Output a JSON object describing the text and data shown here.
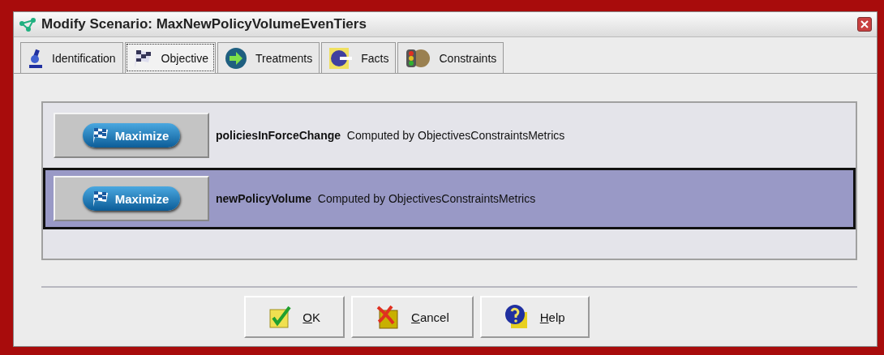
{
  "window": {
    "title": "Modify Scenario: MaxNewPolicyVolumeEvenTiers"
  },
  "tabs": [
    {
      "label": "Identification",
      "kind": "microscope",
      "selected": false
    },
    {
      "label": "Objective",
      "kind": "flag",
      "selected": true
    },
    {
      "label": "Treatments",
      "kind": "arrow",
      "selected": false
    },
    {
      "label": "Facts",
      "kind": "moon",
      "selected": false
    },
    {
      "label": "Constraints",
      "kind": "traffic",
      "selected": false
    }
  ],
  "objectives": [
    {
      "button": "Maximize",
      "name": "policiesInForceChange",
      "description": "Computed by ObjectivesConstraintsMetrics",
      "selected": false
    },
    {
      "button": "Maximize",
      "name": "newPolicyVolume",
      "description": "Computed by ObjectivesConstraintsMetrics",
      "selected": true
    }
  ],
  "buttons": [
    {
      "label": "OK",
      "kind": "check"
    },
    {
      "label": "Cancel",
      "kind": "cancel"
    },
    {
      "label": "Help",
      "kind": "help"
    }
  ]
}
